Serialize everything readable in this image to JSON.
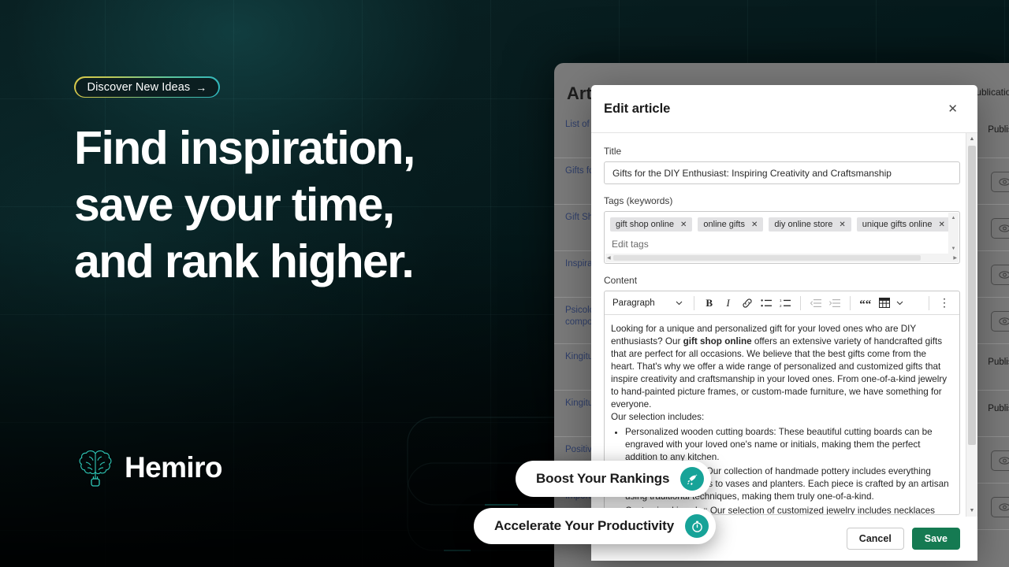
{
  "hero": {
    "badge": {
      "label": "Discover New Ideas",
      "arrow": "→"
    },
    "headline_lines": [
      "Find inspiration,",
      "save your time,",
      "and rank higher."
    ],
    "brand_name": "Hemiro",
    "accent_teal": "#17a398",
    "accent_gold": "#d8c84a",
    "background_color": "#04181a"
  },
  "feature_pills": [
    {
      "label": "Boost Your Rankings",
      "icon": "rocket-icon"
    },
    {
      "label": "Accelerate Your Productivity",
      "icon": "stopwatch-icon"
    }
  ],
  "background_app": {
    "title": "Articles",
    "column_label": "Publication",
    "rows": [
      {
        "title": "List of Gift Ideas",
        "action": "Publish"
      },
      {
        "title": "Gifts for the DIY Enthusiast",
        "action": ""
      },
      {
        "title": "Gift Shop Optimization Guide",
        "action": ""
      },
      {
        "title": "Inspiration für Geschenke",
        "action": ""
      },
      {
        "title": "Psicología del comportamiento",
        "action": ""
      },
      {
        "title": "Kingituste ostsad pood",
        "action": "Publish"
      },
      {
        "title": "Kingituste valaspood",
        "action": "Publish"
      },
      {
        "title": "Positive Gifting",
        "action": ""
      },
      {
        "title": "Importance of Quality",
        "action": ""
      }
    ],
    "eye_icon": "eye-icon",
    "publish_label": "Publish"
  },
  "modal": {
    "title": "Edit article",
    "close_icon": "close-icon",
    "title_field": {
      "label": "Title",
      "value": "Gifts for the DIY Enthusiast: Inspiring Creativity and Craftsmanship"
    },
    "tags_field": {
      "label": "Tags (keywords)",
      "placeholder": "Edit tags",
      "tags": [
        "gift shop online",
        "online gifts",
        "diy online store",
        "unique gifts online"
      ],
      "remove_icon": "close-icon"
    },
    "content_field": {
      "label": "Content",
      "toolbar": {
        "block_style": "Paragraph",
        "chevron_icon": "chevron-down-icon",
        "buttons": [
          {
            "name": "bold-button",
            "glyph": "B"
          },
          {
            "name": "italic-button",
            "glyph": "I"
          },
          {
            "name": "link-button",
            "glyph": "🔗"
          },
          {
            "name": "bullet-list-button",
            "glyph": "☰"
          },
          {
            "name": "numbered-list-button",
            "glyph": "☰"
          },
          {
            "name": "indent-decrease-button",
            "glyph": "⇤"
          },
          {
            "name": "indent-increase-button",
            "glyph": "⇥"
          },
          {
            "name": "blockquote-button",
            "glyph": "“"
          },
          {
            "name": "table-button",
            "glyph": "▦"
          },
          {
            "name": "more-options-button",
            "glyph": "⋮"
          }
        ]
      },
      "paragraph_1_pre": "Looking for a unique and personalized gift for your loved ones who are DIY enthusiasts? Our ",
      "paragraph_1_bold": "gift shop online",
      "paragraph_1_post": " offers an extensive variety of handcrafted gifts that are perfect for all occasions. We believe that the best gifts come from the heart. That's why we offer a wide range of personalized and customized gifts that inspire creativity and craftsmanship in your loved ones. From one-of-a-kind jewelry to hand-painted picture frames, or custom-made furniture, we have something for everyone.",
      "paragraph_2": "Our selection includes:",
      "list_items": [
        "Personalized wooden cutting boards: These beautiful cutting boards can be engraved with your loved one's name or initials, making them the perfect addition to any kitchen.",
        "Handmade pottery: Our collection of handmade pottery includes everything from mugs and bowls to vases and planters. Each piece is crafted by an artisan using traditional techniques, making them truly one-of-a-kind.",
        "Customized jewelry: Our selection of customized jewelry includes necklaces"
      ]
    },
    "footer": {
      "cancel_label": "Cancel",
      "save_label": "Save",
      "save_color": "#157a52"
    }
  }
}
